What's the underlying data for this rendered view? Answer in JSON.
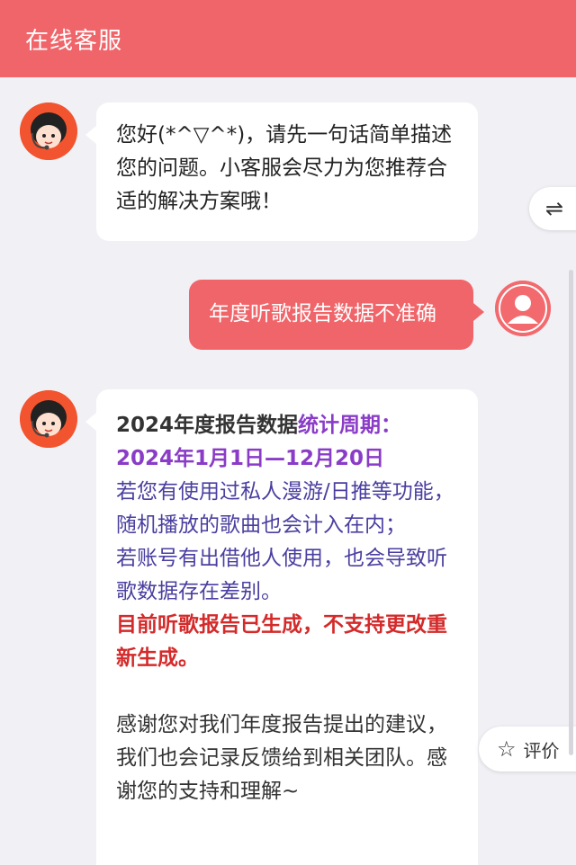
{
  "header": {
    "title": "在线客服"
  },
  "messages": {
    "bot1": {
      "text": "您好(*^▽^*)，请先一句话简单描述您的问题。小客服会尽力为您推荐合适的解决方案哦！"
    },
    "user1": {
      "text": "年度听歌报告数据不准确"
    },
    "bot2": {
      "lead": "2024年度报告数据",
      "period_label": "统计周期：",
      "period": "2024年1月1日—12月20日",
      "note1": "若您有使用过私人漫游/日推等功能，随机播放的歌曲也会计入在内；",
      "note2": "若账号有出借他人使用，也会导致听歌数据存在差别。",
      "warning": "目前听歌报告已生成，不支持更改重新生成。",
      "thanks": "感谢您对我们年度报告提出的建议，我们也会记录反馈给到相关团队。感谢您的支持和理解~"
    }
  },
  "side_buttons": {
    "switch_icon": "⇌",
    "rate_icon": "☆",
    "rate_label": "评价"
  },
  "colors": {
    "header": "#f0656a",
    "background": "#f1f0f5",
    "purple": "#8a3cc7",
    "indigo": "#4a3fa0",
    "red": "#d42a2a"
  }
}
